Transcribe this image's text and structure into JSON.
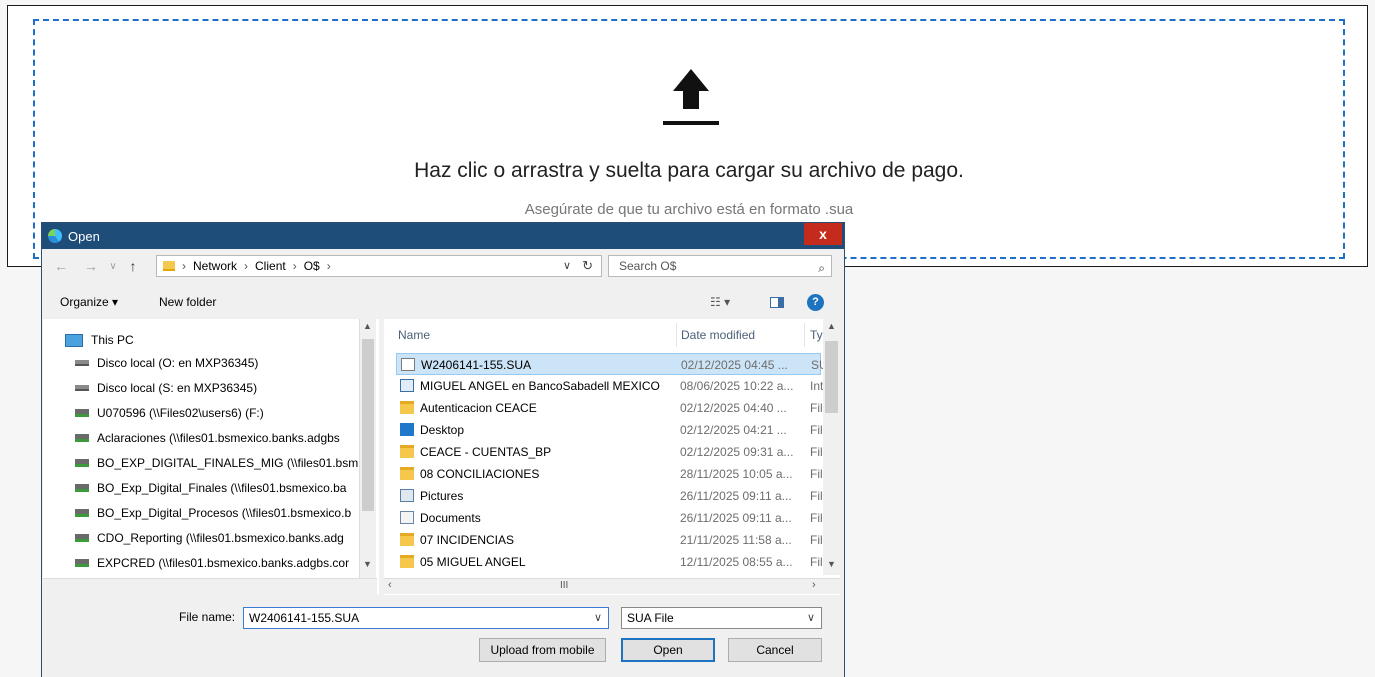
{
  "upload": {
    "title": "Haz clic o arrastra y suelta para cargar su archivo de pago.",
    "subtitle": "Asegúrate de que tu archivo está en formato .sua",
    "icon": "upload-arrow-icon",
    "accent_color": "#1e6fc8"
  },
  "dialog": {
    "title": "Open",
    "close_label": "x",
    "breadcrumb": [
      "Network",
      "Client",
      "O$"
    ],
    "search_placeholder": "Search O$",
    "toolbar": {
      "organize": "Organize ▾",
      "new_folder": "New folder"
    },
    "nav_items": [
      "This PC",
      "Disco local (O: en MXP36345)",
      "Disco local (S: en MXP36345)",
      "U070596 (\\\\Files02\\users6) (F:)",
      "Aclaraciones (\\\\files01.bsmexico.banks.adgbs",
      "BO_EXP_DIGITAL_FINALES_MIG (\\\\files01.bsm",
      "BO_Exp_Digital_Finales (\\\\files01.bsmexico.ba",
      "BO_Exp_Digital_Procesos (\\\\files01.bsmexico.b",
      "CDO_Reporting (\\\\files01.bsmexico.banks.adg",
      "EXPCRED (\\\\files01.bsmexico.banks.adgbs.cor"
    ],
    "columns": {
      "name": "Name",
      "date": "Date modified",
      "type": "Ty"
    },
    "files": [
      {
        "name": "W2406141-155.SUA",
        "date": "02/12/2025 04:45 ...",
        "type": "SU",
        "icon": "file"
      },
      {
        "name": "MIGUEL ANGEL en BancoSabadell MEXICO",
        "date": "08/06/2025 10:22 a...",
        "type": "Int",
        "icon": "shortcut"
      },
      {
        "name": "Autenticacion CEACE",
        "date": "02/12/2025 04:40 ...",
        "type": "Fil",
        "icon": "folder"
      },
      {
        "name": "Desktop",
        "date": "02/12/2025 04:21 ...",
        "type": "Fil",
        "icon": "desktop"
      },
      {
        "name": "CEACE - CUENTAS_BP",
        "date": "02/12/2025 09:31 a...",
        "type": "Fil",
        "icon": "folder"
      },
      {
        "name": "08 CONCILIACIONES",
        "date": "28/11/2025 10:05 a...",
        "type": "Fil",
        "icon": "folder"
      },
      {
        "name": "Pictures",
        "date": "26/11/2025 09:11 a...",
        "type": "Fil",
        "icon": "pictures"
      },
      {
        "name": "Documents",
        "date": "26/11/2025 09:11 a...",
        "type": "Fil",
        "icon": "docs"
      },
      {
        "name": "07 INCIDENCIAS",
        "date": "21/11/2025 11:58 a...",
        "type": "Fil",
        "icon": "folder"
      },
      {
        "name": "05 MIGUEL ANGEL",
        "date": "12/11/2025 08:55 a...",
        "type": "Fil",
        "icon": "folder"
      }
    ],
    "file_name_label": "File name:",
    "file_name_value": "W2406141-155.SUA",
    "file_type": "SUA File",
    "buttons": {
      "upload_mobile": "Upload from mobile",
      "open": "Open",
      "cancel": "Cancel"
    },
    "hscroll_thumb": "III"
  }
}
